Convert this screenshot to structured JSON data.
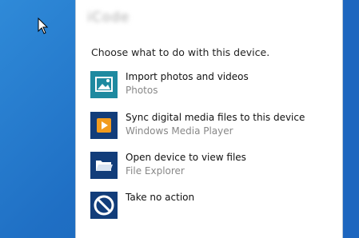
{
  "colors": {
    "desktop": "#1f6fc4",
    "panel": "#ffffff",
    "icon_tile": "#123d7a"
  },
  "dialog": {
    "device_name": "iCode",
    "instruction": "Choose what to do with this device.",
    "options": [
      {
        "icon": "photos-icon",
        "title": "Import photos and videos",
        "subtitle": "Photos"
      },
      {
        "icon": "media-player-icon",
        "title": "Sync digital media files to this device",
        "subtitle": "Windows Media Player"
      },
      {
        "icon": "folder-icon",
        "title": "Open device to view files",
        "subtitle": "File Explorer"
      },
      {
        "icon": "no-action-icon",
        "title": "Take no action",
        "subtitle": ""
      }
    ]
  }
}
